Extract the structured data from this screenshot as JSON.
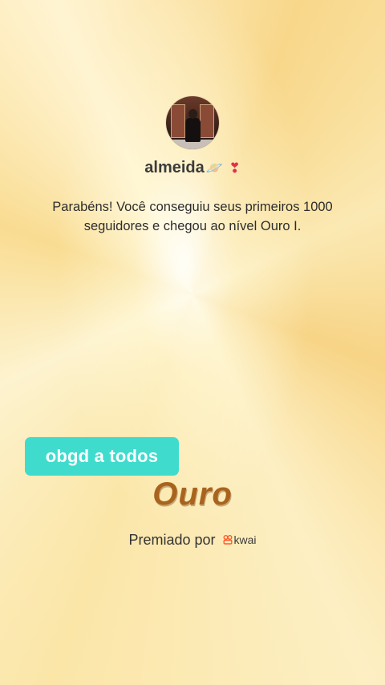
{
  "profile": {
    "username": "almeida",
    "username_emojis": [
      "planet-emoji",
      "heart-exclamation-emoji"
    ],
    "avatar": "profile-avatar"
  },
  "message": "Parabéns! Você conseguiu seus primeiros 1000 seguidores e chegou ao nível Ouro I.",
  "sticker": {
    "text": "obgd a todos",
    "color": "#3fdccd"
  },
  "level": {
    "name": "Ouro",
    "color": "#a9631c"
  },
  "awarded_by": {
    "label": "Premiado por",
    "brand": "kwai",
    "brand_color": "#ff5a2b"
  }
}
